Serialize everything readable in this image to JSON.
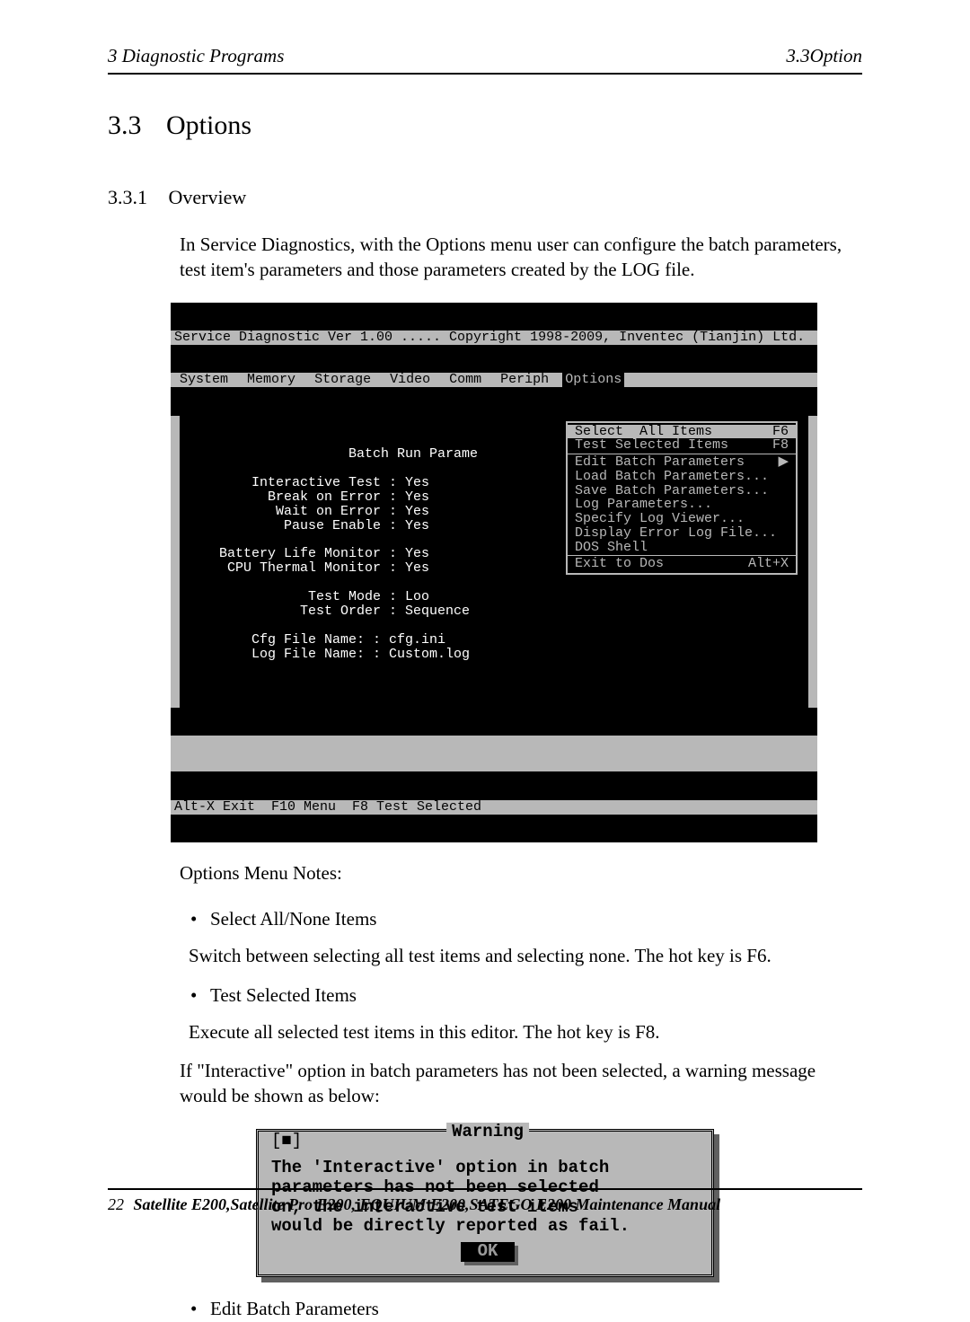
{
  "header": {
    "left": "3  Diagnostic Programs",
    "right": "3.3Option"
  },
  "section": {
    "number": "3.3",
    "title": "Options"
  },
  "subsection": {
    "number": "3.3.1",
    "title": "Overview"
  },
  "intro_paragraph": "In Service Diagnostics, with the Options menu user can configure the batch parameters, test item's parameters and those parameters created by the LOG file.",
  "dos": {
    "titlebar": "Service Diagnostic Ver 1.00 ..... Copyright 1998-2009, Inventec (Tianjin) Ltd.",
    "menubar": [
      "System",
      "Memory",
      "Storage",
      "Video",
      "Comm",
      "Periph",
      "Options"
    ],
    "menubar_selected": "Options",
    "panel_lines": [
      "                    Batch Run Parame",
      "",
      "        Interactive Test : Yes",
      "          Break on Error : Yes",
      "           Wait on Error : Yes",
      "            Pause Enable : Yes",
      "",
      "    Battery Life Monitor : Yes",
      "     CPU Thermal Monitor : Yes",
      "",
      "               Test Mode : Loo",
      "              Test Order : Sequence",
      "",
      "        Cfg File Name: : cfg.ini",
      "        Log File Name: : Custom.log"
    ],
    "dropdown": [
      {
        "label": "Select  All Items",
        "shortcut": "F6",
        "highlight": true
      },
      {
        "label": "Test Selected Items",
        "shortcut": "F8"
      },
      {
        "sep": true
      },
      {
        "label": "Edit Batch Parameters",
        "shortcut": "▶"
      },
      {
        "label": "Load Batch Parameters..."
      },
      {
        "label": "Save Batch Parameters..."
      },
      {
        "label": "Log Parameters..."
      },
      {
        "label": "Specify Log Viewer..."
      },
      {
        "label": "Display Error Log File..."
      },
      {
        "label": "DOS Shell"
      },
      {
        "sep": true
      },
      {
        "label": "Exit to Dos",
        "shortcut": "Alt+X"
      }
    ],
    "statusbar": "Alt-X Exit  F10 Menu  F8 Test Selected"
  },
  "notes_title": "Options Menu Notes:",
  "notes": [
    {
      "title": "Select All/None Items",
      "desc": "Switch between selecting all test items and selecting none. The hot key is F6."
    },
    {
      "title": "Test Selected Items",
      "desc": "Execute all selected test items in this editor. The hot key is F8."
    }
  ],
  "interactive_warning_intro": "If  \"Interactive\" option in batch parameters has not been selected, a warning message would be shown as below:",
  "warning_dialog": {
    "close": "[■]",
    "title": "Warning",
    "message": "The 'Interactive' option in batch\nparameters has not been selected\non, the interactive test items\nwould be directly reported as fail.",
    "ok": "OK"
  },
  "notes_after": [
    {
      "title": "Edit Batch Parameters"
    }
  ],
  "footer": {
    "page": "22",
    "manual": "Satellite E200,Satellite Pro E200, EQUIUM E200,SATEGO E200 Maintenance Manual"
  }
}
